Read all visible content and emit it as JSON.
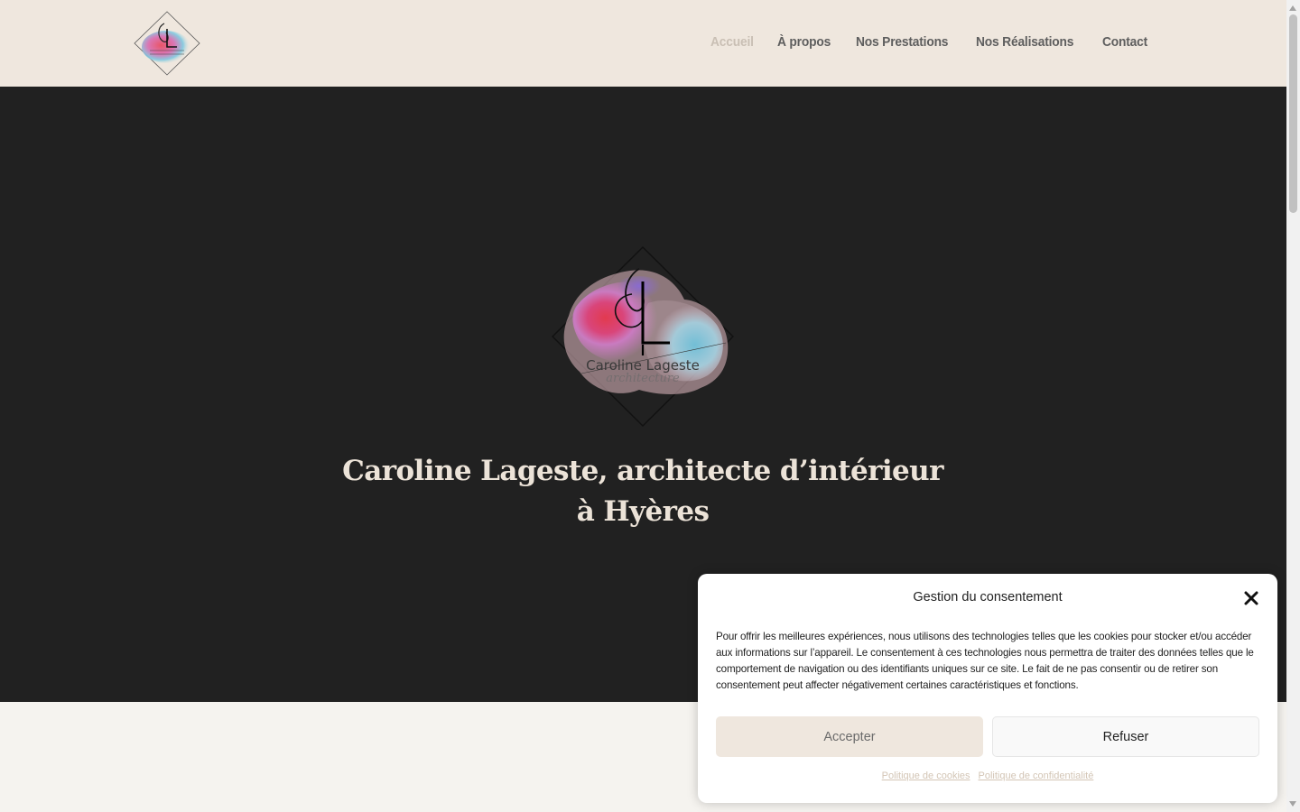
{
  "header": {
    "logo_alt": "Caroline Lageste Architecture",
    "nav": [
      {
        "label": "Accueil",
        "active": true
      },
      {
        "label": "À propos",
        "active": false
      },
      {
        "label": "Nos Prestations",
        "active": false
      },
      {
        "label": "Nos Réalisations",
        "active": false
      },
      {
        "label": "Contact",
        "active": false
      }
    ]
  },
  "hero": {
    "logo_text_1": "Caroline Lageste",
    "logo_text_2": "architecture",
    "title_line_1": "Caroline Lageste, architecte d’intérieur",
    "title_line_2": "à Hyères"
  },
  "consent": {
    "title": "Gestion du consentement",
    "text": "Pour offrir les meilleures expériences, nous utilisons des technologies telles que les cookies pour stocker et/ou accéder aux informations sur l’appareil. Le consentement à ces technologies nous permettra de traiter des données telles que le comportement de navigation ou des identifiants uniques sur ce site. Le fait de ne pas consentir ou de retirer son consentement peut affecter négativement certaines caractéristiques et fonctions.",
    "accept_label": "Accepter",
    "refuse_label": "Refuser",
    "cookie_policy_label": "Politique de cookies",
    "privacy_policy_label": "Politique de confidentialité"
  },
  "colors": {
    "header_bg": "#efe7de",
    "hero_bg": "#212121",
    "hero_title": "#ece3d8",
    "nav_text": "#5e5e5e",
    "nav_active": "#c9bfb4",
    "accept_bg": "#efe7de",
    "link_color": "#d3c5b5"
  }
}
